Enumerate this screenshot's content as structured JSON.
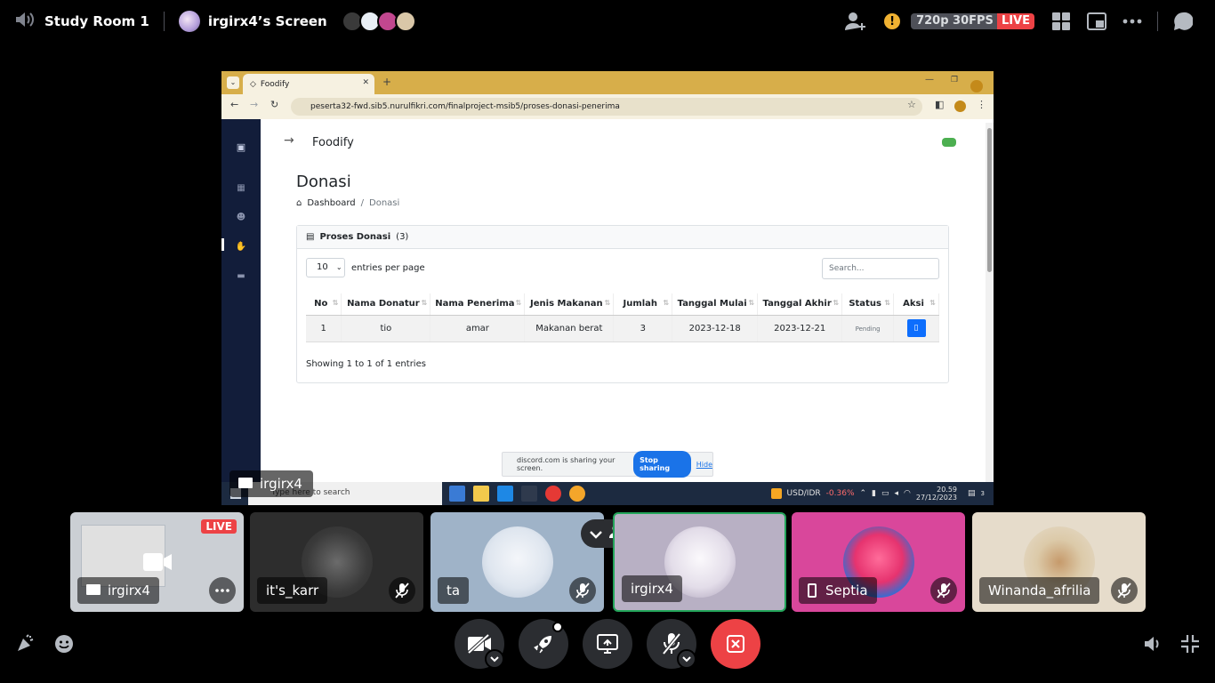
{
  "topbar": {
    "channel_name": "Study Room 1",
    "screen_title": "irgirx4’s Screen",
    "quality": "720p 30FPS",
    "live": "LIVE",
    "icons": [
      "speaker-icon",
      "add-user-icon",
      "warning-icon",
      "grid-icon",
      "popout-icon",
      "more-icon",
      "chat-icon"
    ]
  },
  "stream": {
    "browser": {
      "tab_title": "Foodify",
      "url": "peserta32-fwd.sib5.nurulfikri.com/finalproject-msib5/proses-donasi-penerima"
    },
    "app": {
      "brand": "Foodify",
      "page_title": "Donasi",
      "breadcrumb": {
        "home": "Dashboard",
        "current": "Donasi"
      },
      "card_title": "Proses Donasi",
      "card_count": "(3)",
      "per_page_value": "10",
      "per_page_label": "entries per page",
      "search_placeholder": "Search...",
      "columns": [
        "No",
        "Nama Donatur",
        "Nama Penerima",
        "Jenis Makanan",
        "Jumlah",
        "Tanggal Mulai",
        "Tanggal Akhir",
        "Status",
        "Aksi"
      ],
      "rows": [
        {
          "no": "1",
          "donatur": "tio",
          "penerima": "amar",
          "jenis": "Makanan berat",
          "jumlah": "3",
          "mulai": "2023-12-18",
          "akhir": "2023-12-21",
          "status": "Pending"
        }
      ],
      "showing": "Showing 1 to 1 of 1 entries"
    },
    "share_bar": {
      "text": "discord.com is sharing your screen.",
      "stop": "Stop sharing",
      "hide": "Hide"
    },
    "taskbar": {
      "search": "Type here to search",
      "fx_pair": "USD/IDR",
      "fx_change": "-0.36%",
      "time": "20.59",
      "date": "27/12/2023",
      "notif": "3"
    },
    "streamer_label": "irgirx4"
  },
  "participants": [
    {
      "name": "irgirx4",
      "live": "LIVE"
    },
    {
      "name": "it's_karr"
    },
    {
      "name": "ta"
    },
    {
      "name": "irgirx4"
    },
    {
      "name": "Septia"
    },
    {
      "name": "Winanda_afrilia"
    }
  ],
  "colors": {
    "live_red": "#ed4245",
    "speaking_green": "#23a55a",
    "warning_yellow": "#f0b232",
    "app_sidebar": "#121d3a",
    "primary_blue": "#0d6efd"
  }
}
